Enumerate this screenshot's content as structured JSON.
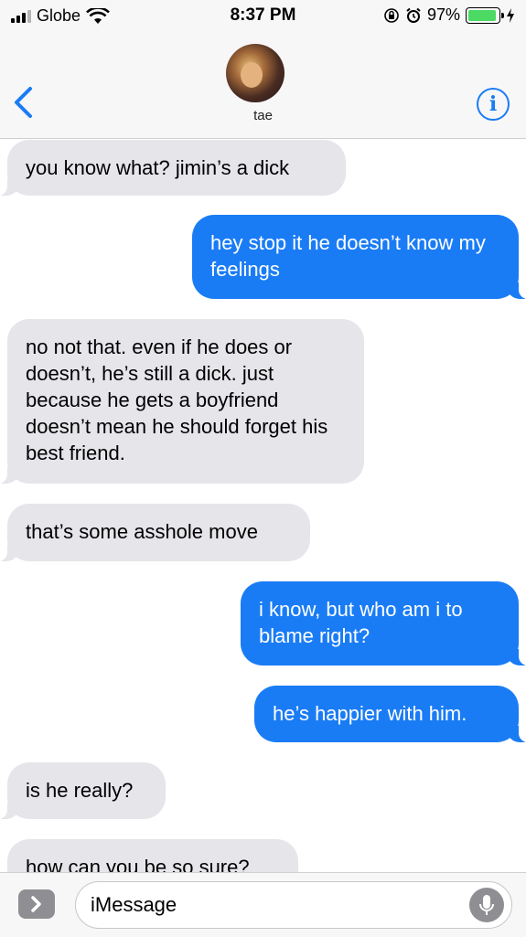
{
  "status_bar": {
    "carrier": "Globe",
    "time": "8:37 PM",
    "battery_percent": "97%",
    "icons": [
      "signal-icon",
      "wifi-icon",
      "rotation-lock-icon",
      "alarm-icon",
      "battery-icon",
      "charging-icon"
    ]
  },
  "header": {
    "contact_name": "tae",
    "back_icon": "chevron-left-icon",
    "info_label": "i"
  },
  "messages": [
    {
      "sender": "received",
      "text": "you know what? jimin’s a dick"
    },
    {
      "sender": "sent",
      "text": "hey stop it he doesn’t know my feelings"
    },
    {
      "sender": "received",
      "text": "no not that. even if he does or doesn’t, he’s still a dick. just because he gets a boyfriend doesn’t mean he should forget his best friend."
    },
    {
      "sender": "received",
      "text": "that’s some asshole move"
    },
    {
      "sender": "sent",
      "text": "i know, but who am i to blame right?"
    },
    {
      "sender": "sent",
      "text": "he’s happier with him."
    },
    {
      "sender": "received",
      "text": "is he really?"
    },
    {
      "sender": "received",
      "text": "how can you be so sure?"
    }
  ],
  "input_bar": {
    "placeholder": "iMessage",
    "app_button_icon": "chevron-right-icon",
    "mic_icon": "microphone-icon"
  },
  "colors": {
    "sent_bubble": "#1a7cf5",
    "received_bubble": "#e5e5ea",
    "accent": "#1a7cf5",
    "battery": "#4cd964"
  }
}
